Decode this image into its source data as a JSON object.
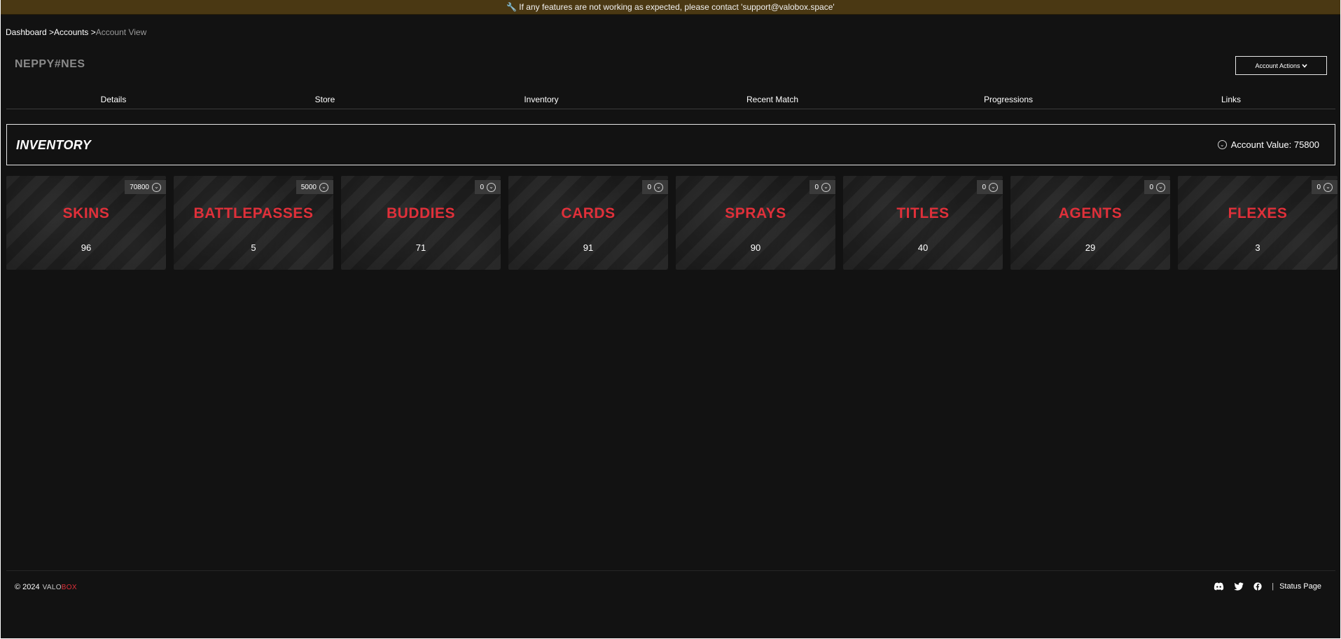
{
  "banner": {
    "icon": "wrench-icon",
    "text": "If any features are not working as expected, please contact 'support@valobox.space'"
  },
  "breadcrumb": {
    "items": [
      "Dashboard >",
      "Accounts >"
    ],
    "current": "Account View"
  },
  "account": {
    "name": "NEPPY#NES",
    "actions_label": "Account Actions"
  },
  "tabs": [
    "Details",
    "Store",
    "Inventory",
    "Recent Match",
    "Progressions",
    "Links"
  ],
  "inventory": {
    "title": "INVENTORY",
    "value_label": "Account Value: 75800"
  },
  "categories": [
    {
      "name": "SKINS",
      "count": "96",
      "value": "70800"
    },
    {
      "name": "BATTLEPASSES",
      "count": "5",
      "value": "5000"
    },
    {
      "name": "BUDDIES",
      "count": "71",
      "value": "0"
    },
    {
      "name": "CARDS",
      "count": "91",
      "value": "0"
    },
    {
      "name": "SPRAYS",
      "count": "90",
      "value": "0"
    },
    {
      "name": "TITLES",
      "count": "40",
      "value": "0"
    },
    {
      "name": "AGENTS",
      "count": "29",
      "value": "0"
    },
    {
      "name": "FLEXES",
      "count": "3",
      "value": "0"
    }
  ],
  "footer": {
    "copyright": "© 2024",
    "brand_a": "VALO",
    "brand_b": "BOX",
    "separator": "|",
    "status_link": "Status Page",
    "social_icons": [
      "discord-icon",
      "twitter-icon",
      "facebook-icon"
    ]
  },
  "colors": {
    "accent_red": "#e0303a",
    "banner_bg": "#4a3813",
    "page_bg": "#121212"
  }
}
